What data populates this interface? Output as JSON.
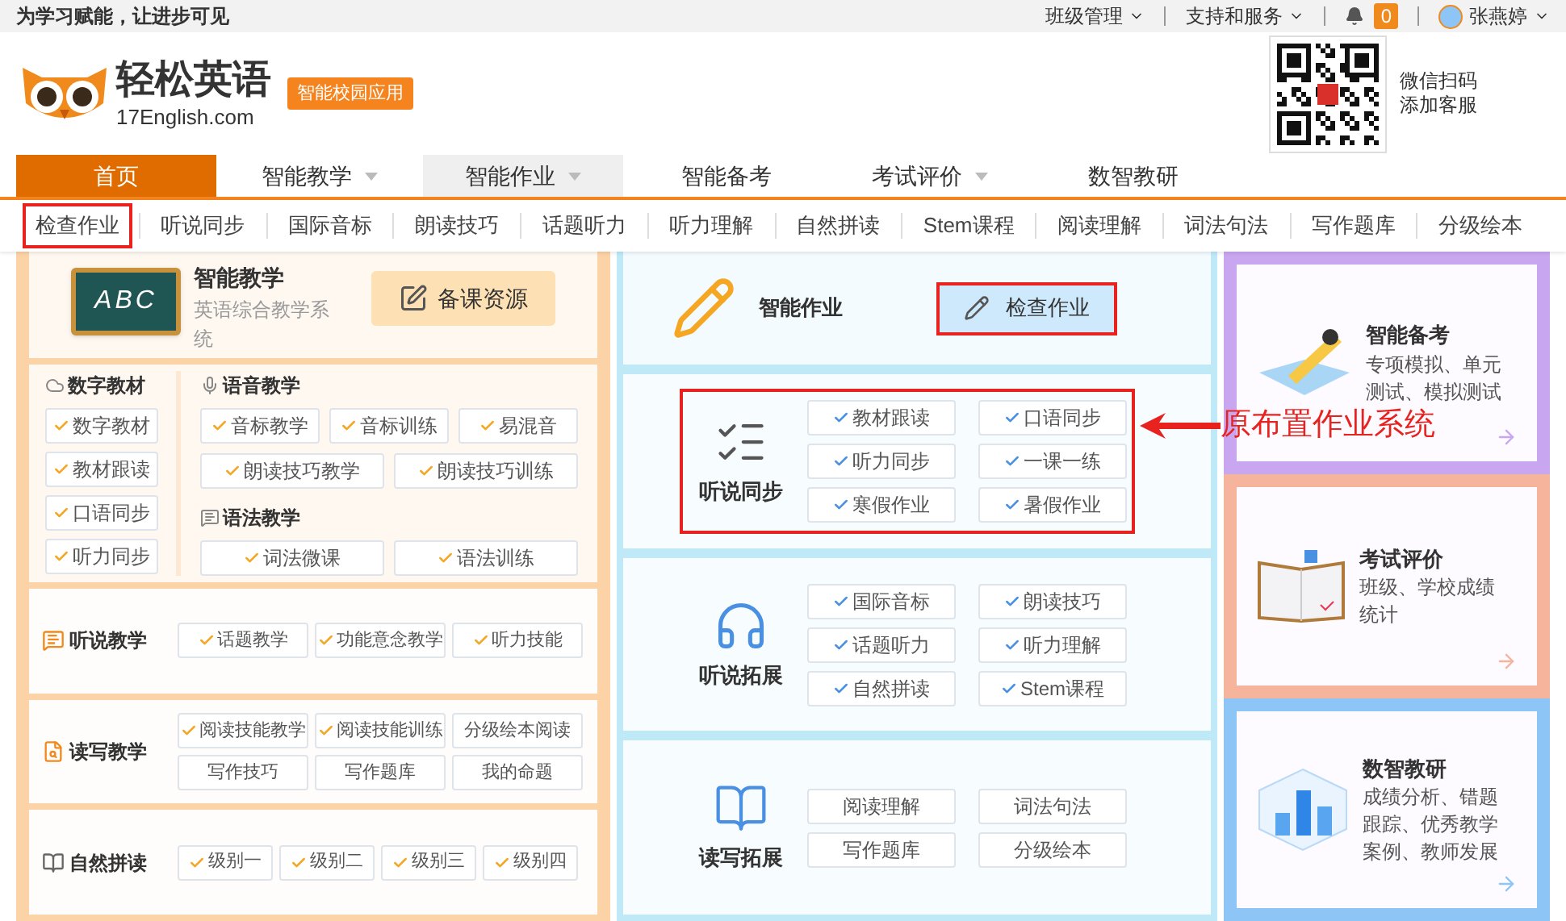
{
  "topbar": {
    "slogan": "为学习赋能，让进步可见",
    "menus": [
      {
        "label": "班级管理"
      },
      {
        "label": "支持和服务"
      }
    ],
    "notification_count": "0",
    "user": "张燕婷"
  },
  "header": {
    "brand": "轻松英语",
    "site": "17English.com",
    "badge": "智能校园应用",
    "qr_caption": [
      "微信扫码",
      "添加客服"
    ]
  },
  "nav": [
    {
      "label": "首页",
      "selected": true,
      "dropdown": false,
      "highlighted": false
    },
    {
      "label": "智能教学",
      "selected": false,
      "dropdown": true,
      "highlighted": false
    },
    {
      "label": "智能作业",
      "selected": false,
      "dropdown": true,
      "highlighted": true
    },
    {
      "label": "智能备考",
      "selected": false,
      "dropdown": false,
      "highlighted": false
    },
    {
      "label": "考试评价",
      "selected": false,
      "dropdown": true,
      "highlighted": false
    },
    {
      "label": "数智教研",
      "selected": false,
      "dropdown": false,
      "highlighted": false
    }
  ],
  "subnav": [
    {
      "label": "检查作业",
      "marked": true
    },
    {
      "label": "听说同步",
      "marked": false
    },
    {
      "label": "国际音标",
      "marked": false
    },
    {
      "label": "朗读技巧",
      "marked": false
    },
    {
      "label": "话题听力",
      "marked": false
    },
    {
      "label": "听力理解",
      "marked": false
    },
    {
      "label": "自然拼读",
      "marked": false
    },
    {
      "label": "Stem课程",
      "marked": false
    },
    {
      "label": "阅读理解",
      "marked": false
    },
    {
      "label": "词法句法",
      "marked": false
    },
    {
      "label": "写作题库",
      "marked": false
    },
    {
      "label": "分级绘本",
      "marked": false
    }
  ],
  "teaching": {
    "board_text": "ABC",
    "title": "智能教学",
    "description": "英语综合教学系统",
    "resource_button": "备课资源",
    "digital": {
      "title": "数字教材",
      "items": [
        {
          "label": "数字教材",
          "checked": true
        },
        {
          "label": "教材跟读",
          "checked": true
        },
        {
          "label": "口语同步",
          "checked": true
        },
        {
          "label": "听力同步",
          "checked": true
        }
      ]
    },
    "phonics": {
      "title": "语音教学",
      "items": [
        {
          "label": "音标教学",
          "checked": true
        },
        {
          "label": "音标训练",
          "checked": true
        },
        {
          "label": "易混音",
          "checked": true
        },
        {
          "label": "朗读技巧教学",
          "checked": true
        },
        {
          "label": "朗读技巧训练",
          "checked": true
        }
      ]
    },
    "grammar": {
      "title": "语法教学",
      "items": [
        {
          "label": "词法微课",
          "checked": true
        },
        {
          "label": "语法训练",
          "checked": true
        }
      ]
    },
    "rows": [
      {
        "kind": "listen",
        "title": "听说教学",
        "items": [
          {
            "label": "话题教学",
            "checked": true
          },
          {
            "label": "功能意念教学",
            "checked": true
          },
          {
            "label": "听力技能",
            "checked": true
          }
        ]
      },
      {
        "kind": "read",
        "title": "读写教学",
        "items": [
          {
            "label": "阅读技能教学",
            "checked": true
          },
          {
            "label": "阅读技能训练",
            "checked": true
          },
          {
            "label": "分级绘本阅读",
            "checked": false
          },
          {
            "label": "写作技巧",
            "checked": false
          },
          {
            "label": "写作题库",
            "checked": false
          },
          {
            "label": "我的命题",
            "checked": false
          }
        ]
      },
      {
        "kind": "phonics",
        "title": "自然拼读",
        "items": [
          {
            "label": "级别一",
            "checked": true
          },
          {
            "label": "级别二",
            "checked": true
          },
          {
            "label": "级别三",
            "checked": true
          },
          {
            "label": "级别四",
            "checked": true
          }
        ]
      }
    ]
  },
  "homework": {
    "title": "智能作业",
    "check_button": {
      "label": "检查作业",
      "marked": true
    },
    "groups": [
      {
        "kind": "sync",
        "title": "听说同步",
        "marked": true,
        "items": [
          {
            "label": "教材跟读",
            "checked": true
          },
          {
            "label": "口语同步",
            "checked": true
          },
          {
            "label": "听力同步",
            "checked": true
          },
          {
            "label": "一课一练",
            "checked": true
          },
          {
            "label": "寒假作业",
            "checked": true
          },
          {
            "label": "暑假作业",
            "checked": true
          }
        ]
      },
      {
        "kind": "headphones",
        "title": "听说拓展",
        "marked": false,
        "items": [
          {
            "label": "国际音标",
            "checked": true
          },
          {
            "label": "朗读技巧",
            "checked": true
          },
          {
            "label": "话题听力",
            "checked": true
          },
          {
            "label": "听力理解",
            "checked": true
          },
          {
            "label": "自然拼读",
            "checked": true
          },
          {
            "label": "Stem课程",
            "checked": true
          }
        ]
      },
      {
        "kind": "book",
        "title": "读写拓展",
        "marked": false,
        "items": [
          {
            "label": "阅读理解",
            "checked": false
          },
          {
            "label": "词法句法",
            "checked": false
          },
          {
            "label": "写作题库",
            "checked": false
          },
          {
            "label": "分级绘本",
            "checked": false
          }
        ]
      }
    ]
  },
  "cards": [
    {
      "kind": "exam",
      "title": "智能备考",
      "description": "专项模拟、单元测试、模拟测试",
      "color": "#c9a6f0"
    },
    {
      "kind": "evaluation",
      "title": "考试评价",
      "description": "班级、学校成绩统计",
      "color": "#f7b49c"
    },
    {
      "kind": "research",
      "title": "数智教研",
      "description": "成绩分析、错题跟踪、优秀教学案例、教师发展",
      "color": "#8ec5f7"
    }
  ],
  "annotation": {
    "text": "原布置作业系统"
  }
}
